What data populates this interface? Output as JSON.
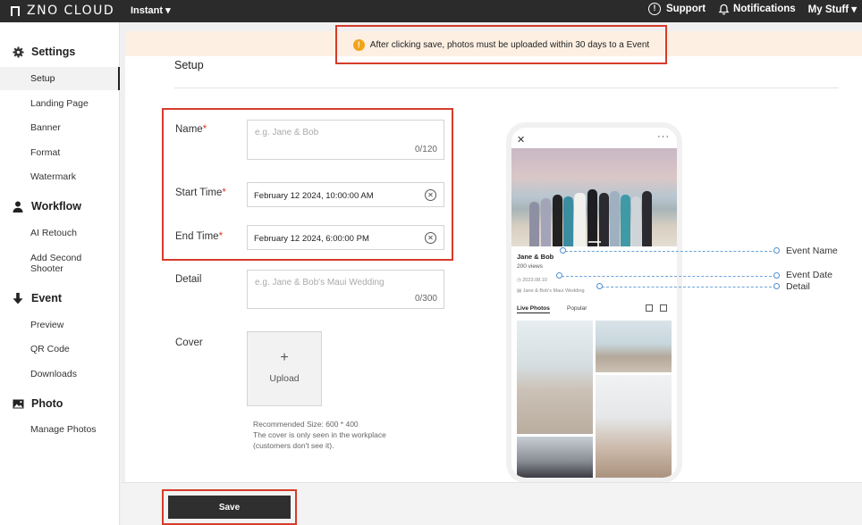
{
  "topbar": {
    "logo": "ZNO CLOUD",
    "product": "Instant ▾",
    "support": "Support",
    "notifications": "Notifications",
    "my_stuff": "My Stuff ▾"
  },
  "sidebar": {
    "sections": [
      {
        "label": "Settings",
        "icon": "gear-icon",
        "items": [
          "Setup",
          "Landing Page",
          "Banner",
          "Format",
          "Watermark"
        ]
      },
      {
        "label": "Workflow",
        "icon": "person-icon",
        "items": [
          "AI Retouch",
          "Add Second Shooter"
        ]
      },
      {
        "label": "Event",
        "icon": "arrow-down-icon",
        "items": [
          "Preview",
          "QR Code",
          "Downloads"
        ]
      },
      {
        "label": "Photo",
        "icon": "photo-icon",
        "items": [
          "Manage Photos"
        ]
      }
    ],
    "active_item": "Setup"
  },
  "banner": {
    "text": "After clicking save, photos must be uploaded within 30 days to a Event"
  },
  "page": {
    "title": "Setup"
  },
  "form": {
    "name": {
      "label": "Name",
      "placeholder": "e.g. Jane & Bob",
      "counter": "0/120"
    },
    "start_time": {
      "label": "Start Time",
      "value": "February 12 2024, 10:00:00 AM"
    },
    "end_time": {
      "label": "End Time",
      "value": "February 12 2024, 6:00:00 PM"
    },
    "detail": {
      "label": "Detail",
      "placeholder": "e.g. Jane & Bob's Maui Wedding",
      "counter": "0/300"
    },
    "cover": {
      "label": "Cover",
      "upload_label": "Upload",
      "notes": [
        "Recommended Size: 600 * 400",
        "The cover is only seen in the workplace",
        "(customers don't see it)."
      ]
    },
    "required_mark": "*"
  },
  "preview": {
    "event_name": "Jane & Bob",
    "views": "200 views",
    "date": "2023.08.10",
    "detail": "Jane & Bob's Maui Wedding",
    "tabs": [
      "Live Photos",
      "Popular"
    ],
    "annotations": [
      "Event Name",
      "Event Date",
      "Detail"
    ]
  },
  "footer": {
    "save_label": "Save"
  },
  "colors": {
    "accent_red": "#d63b2b",
    "warning_orange": "#f0a41a",
    "annotation_blue": "#4e90cf",
    "dark": "#2b2b2b"
  }
}
